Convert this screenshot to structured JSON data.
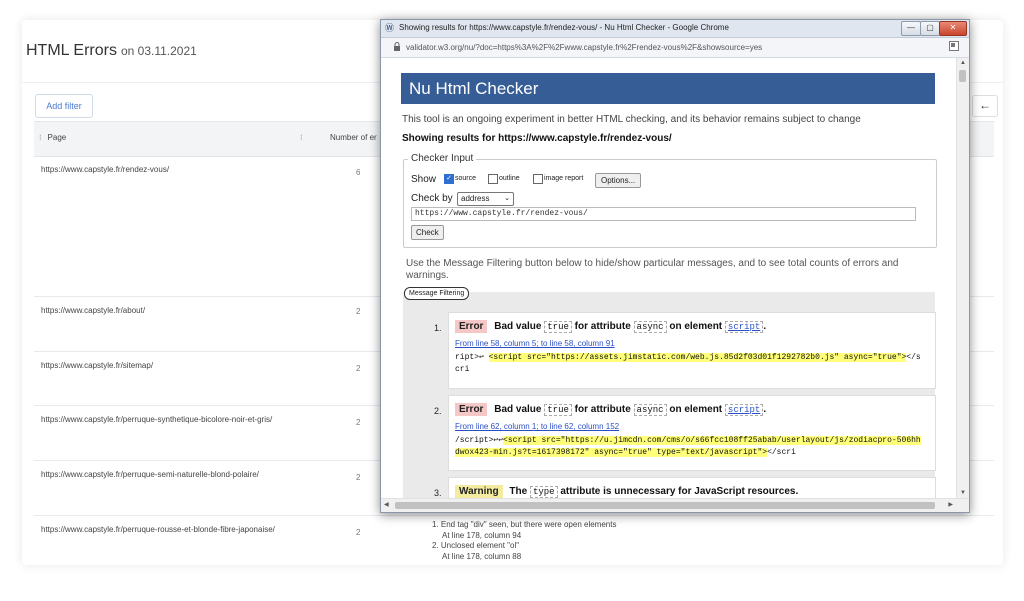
{
  "report": {
    "title": "HTML Errors",
    "date": "on 03.11.2021",
    "add_filter": "Add filter",
    "back_icon": "←",
    "col_page": "Page",
    "col_number": "Number of er",
    "rows": [
      {
        "url": "https://www.capstyle.fr/rendez-vous/",
        "count": "6",
        "messages": []
      },
      {
        "url": "https://www.capstyle.fr/about/",
        "count": "2",
        "messages": []
      },
      {
        "url": "https://www.capstyle.fr/sitemap/",
        "count": "2",
        "messages": []
      },
      {
        "url": "https://www.capstyle.fr/perruque-synthetique-bicolore-noir-et-gris/",
        "count": "2",
        "messages": []
      },
      {
        "url": "https://www.capstyle.fr/perruque-semi-naturelle-blond-polaire/",
        "count": "2",
        "messages": []
      },
      {
        "url": "https://www.capstyle.fr/perruque-rousse-et-blonde-fibre-japonaise/",
        "count": "2",
        "messages": [
          "1. End tag \"div\" seen, but there were open elements",
          "At line 178, column 94",
          "2. Unclosed element \"ol\"",
          "At line 178, column 88"
        ]
      }
    ]
  },
  "chrome": {
    "window_title": "Showing results for https://www.capstyle.fr/rendez-vous/ - Nu Html Checker - Google Chrome",
    "address": "validator.w3.org/nu/?doc=https%3A%2F%2Fwww.capstyle.fr%2Frendez-vous%2F&showsource=yes",
    "min": "—",
    "max": "▢",
    "close": "✕"
  },
  "checker": {
    "heading": "Nu Html Checker",
    "intro": "This tool is an ongoing experiment in better HTML checking, and its behavior remains subject to change",
    "showing": "Showing results for https://www.capstyle.fr/rendez-vous/",
    "legend": "Checker Input",
    "show_label": "Show",
    "opt_source": "source",
    "opt_outline": "outline",
    "opt_image_report": "image report",
    "options_btn": "Options...",
    "check_by_label": "Check by",
    "check_by_value": "address",
    "url_value": "https://www.capstyle.fr/rendez-vous/",
    "check_btn": "Check",
    "filter_text": "Use the Message Filtering button below to hide/show particular messages, and to see total counts of errors and warnings.",
    "filter_btn": "Message Filtering",
    "messages": [
      {
        "num": "1.",
        "type": "Error",
        "t1": "Bad value",
        "c1": "true",
        "t2": "for attribute",
        "c2": "async",
        "t3": "on element",
        "c3": "script",
        "t4": ".",
        "loc": "From line 58, column 5; to line 58, column 91",
        "ext_pre": "ript>↩      ",
        "ext_hl": "<script src=\"https://assets.jimstatic.com/web.js.85d2f03d01f1292782b0.js\" async=\"true\">",
        "ext_post": "</scri"
      },
      {
        "num": "2.",
        "type": "Error",
        "t1": "Bad value",
        "c1": "true",
        "t2": "for attribute",
        "c2": "async",
        "t3": "on element",
        "c3": "script",
        "t4": ".",
        "loc": "From line 62, column 1; to line 62, column 152",
        "ext_pre": "/script>↩↩",
        "ext_hl": "<script src=\"https://u.jimcdn.com/cms/o/s66fcc108ff25abab/userlayout/js/zodiacpro-506hhdwox423-min.js?t=1617398172\" async=\"true\" type=\"text/javascript\">",
        "ext_post": "</scri"
      },
      {
        "num": "3.",
        "type": "Warning",
        "t1": "The",
        "c1": "type",
        "t2": "attribute is unnecessary for JavaScript resources."
      }
    ]
  }
}
